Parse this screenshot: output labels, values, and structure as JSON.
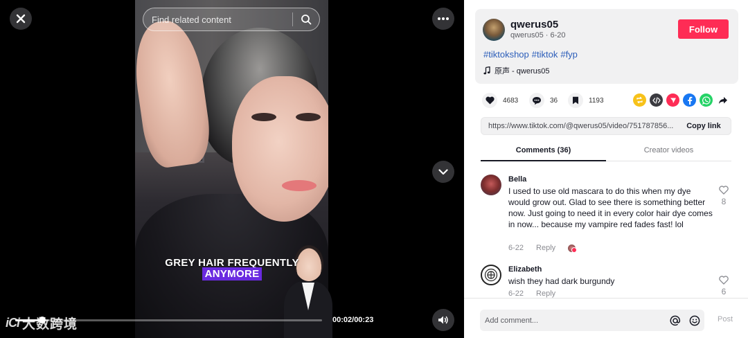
{
  "video": {
    "search_placeholder": "Find related content",
    "caption_line1": "GREY HAIR FREQUENTLY",
    "caption_line2": "ANYMORE",
    "time": "00:02/00:23",
    "progress": 0.087,
    "watermark_logo": "iCi",
    "watermark_text": "大数跨境"
  },
  "author": {
    "username": "qwerus05",
    "meta": "qwerus05 · 6-20",
    "follow_label": "Follow",
    "hashtags": [
      "#tiktokshop",
      "#tiktok",
      "#fyp"
    ],
    "music": "原声 - qwerus05"
  },
  "stats": {
    "likes": "4683",
    "comments": "36",
    "saves": "1193"
  },
  "share_icons": [
    "repost-icon",
    "embed-icon",
    "send-icon",
    "facebook-icon",
    "whatsapp-icon",
    "share-arrow-icon"
  ],
  "link": {
    "url": "https://www.tiktok.com/@qwerus05/video/751787856...",
    "copy_label": "Copy link"
  },
  "tabs": {
    "comments": "Comments (36)",
    "creator_videos": "Creator videos"
  },
  "comments": [
    {
      "user": "Bella",
      "text": "I used to use old mascara to do this when my dye would grow out. Glad to see there is something better now. Just going to need it in every color hair dye comes in now... because my vampire red fades fast! lol",
      "date": "6-22",
      "reply": "Reply",
      "likes": "8"
    },
    {
      "user": "Elizabeth",
      "text": "wish they had dark burgundy",
      "date": "6-22",
      "reply": "Reply",
      "likes": "6"
    }
  ],
  "comment_bar": {
    "placeholder": "Add comment...",
    "post_label": "Post"
  },
  "colors": {
    "accent": "#fe2c55",
    "hashtag": "#2b5db9",
    "caption_highlight": "#6a2ae0"
  }
}
